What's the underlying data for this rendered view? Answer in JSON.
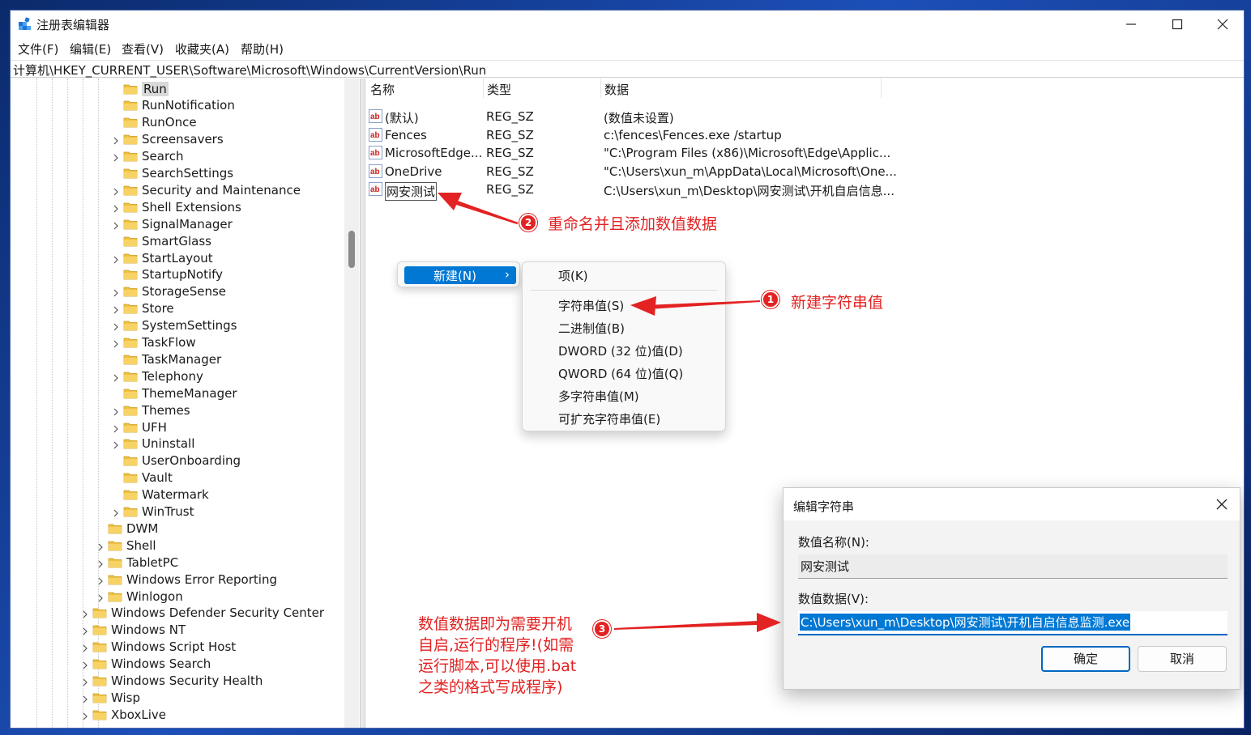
{
  "window": {
    "title": "注册表编辑器"
  },
  "colors": {
    "accent": "#0078d4",
    "annotation": "#e32222",
    "folder": "#f0c040"
  },
  "menu": [
    "文件(F)",
    "编辑(E)",
    "查看(V)",
    "收藏夹(A)",
    "帮助(H)"
  ],
  "address": "计算机\\HKEY_CURRENT_USER\\Software\\Microsoft\\Windows\\CurrentVersion\\Run",
  "tree": {
    "selected": "Run",
    "items": [
      {
        "label": "Run",
        "expandable": false
      },
      {
        "label": "RunNotification",
        "expandable": false
      },
      {
        "label": "RunOnce",
        "expandable": false
      },
      {
        "label": "Screensavers",
        "expandable": true
      },
      {
        "label": "Search",
        "expandable": true
      },
      {
        "label": "SearchSettings",
        "expandable": false
      },
      {
        "label": "Security and Maintenance",
        "expandable": true
      },
      {
        "label": "Shell Extensions",
        "expandable": true
      },
      {
        "label": "SignalManager",
        "expandable": true
      },
      {
        "label": "SmartGlass",
        "expandable": false
      },
      {
        "label": "StartLayout",
        "expandable": true
      },
      {
        "label": "StartupNotify",
        "expandable": false
      },
      {
        "label": "StorageSense",
        "expandable": true
      },
      {
        "label": "Store",
        "expandable": true
      },
      {
        "label": "SystemSettings",
        "expandable": true
      },
      {
        "label": "TaskFlow",
        "expandable": true
      },
      {
        "label": "TaskManager",
        "expandable": false
      },
      {
        "label": "Telephony",
        "expandable": true
      },
      {
        "label": "ThemeManager",
        "expandable": false
      },
      {
        "label": "Themes",
        "expandable": true
      },
      {
        "label": "UFH",
        "expandable": true
      },
      {
        "label": "Uninstall",
        "expandable": true
      },
      {
        "label": "UserOnboarding",
        "expandable": false
      },
      {
        "label": "Vault",
        "expandable": false
      },
      {
        "label": "Watermark",
        "expandable": false
      },
      {
        "label": "WinTrust",
        "expandable": true
      },
      {
        "label": "DWM",
        "expandable": false
      },
      {
        "label": "Shell",
        "expandable": true
      },
      {
        "label": "TabletPC",
        "expandable": true
      },
      {
        "label": "Windows Error Reporting",
        "expandable": true
      },
      {
        "label": "Winlogon",
        "expandable": true
      },
      {
        "label": "Windows Defender Security Center",
        "expandable": true
      },
      {
        "label": "Windows NT",
        "expandable": true
      },
      {
        "label": "Windows Script Host",
        "expandable": true
      },
      {
        "label": "Windows Search",
        "expandable": true
      },
      {
        "label": "Windows Security Health",
        "expandable": true
      },
      {
        "label": "Wisp",
        "expandable": true
      },
      {
        "label": "XboxLive",
        "expandable": true
      }
    ]
  },
  "values": {
    "headers": [
      "名称",
      "类型",
      "数据"
    ],
    "rows": [
      {
        "name": "(默认)",
        "type": "REG_SZ",
        "data": "(数值未设置)"
      },
      {
        "name": "Fences",
        "type": "REG_SZ",
        "data": "c:\\fences\\Fences.exe /startup"
      },
      {
        "name": "MicrosoftEdge...",
        "type": "REG_SZ",
        "data": "\"C:\\Program Files (x86)\\Microsoft\\Edge\\Applic..."
      },
      {
        "name": "OneDrive",
        "type": "REG_SZ",
        "data": "\"C:\\Users\\xun_m\\AppData\\Local\\Microsoft\\One..."
      },
      {
        "name": "网安测试",
        "type": "REG_SZ",
        "data": "C:\\Users\\xun_m\\Desktop\\网安测试\\开机自启信息..."
      }
    ]
  },
  "context_menu": {
    "new_label": "新建(N)",
    "submenu": [
      "项(K)",
      "字符串值(S)",
      "二进制值(B)",
      "DWORD (32 位)值(D)",
      "QWORD (64 位)值(Q)",
      "多字符串值(M)",
      "可扩充字符串值(E)"
    ]
  },
  "dialog": {
    "title": "编辑字符串",
    "name_label": "数值名称(N):",
    "name_value": "网安测试",
    "data_label": "数值数据(V):",
    "data_value": "C:\\Users\\xun_m\\Desktop\\网安测试\\开机自启信息监测.exe",
    "ok_label": "确定",
    "cancel_label": "取消"
  },
  "annotations": {
    "step1_number": "1",
    "step1_text": "新建字符串值",
    "step2_number": "2",
    "step2_text": "重命名并且添加数值数据",
    "step3_number": "3",
    "step3_text": "数值数据即为需要开机自启,运行的程序!(如需运行脚本,可以使用.bat之类的格式写成程序)"
  }
}
